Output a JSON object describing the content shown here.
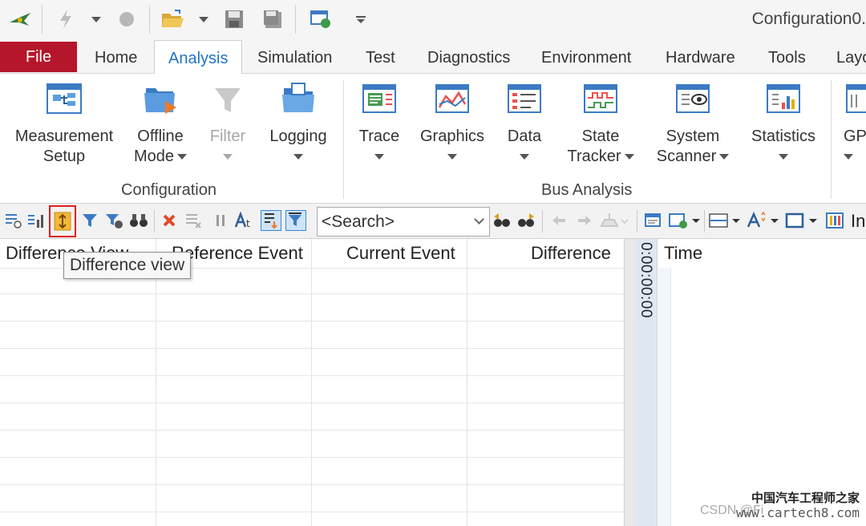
{
  "window": {
    "title": "Configuration0."
  },
  "quick_access": {
    "icons": [
      "app-logo-icon",
      "lightning-icon",
      "chevron-down-icon",
      "stop-icon",
      "open-folder-icon",
      "chevron-down-icon",
      "save-icon",
      "save-all-icon",
      "publish-icon",
      "customize-icon"
    ]
  },
  "tabs": [
    {
      "label": "File"
    },
    {
      "label": "Home"
    },
    {
      "label": "Analysis"
    },
    {
      "label": "Simulation"
    },
    {
      "label": "Test"
    },
    {
      "label": "Diagnostics"
    },
    {
      "label": "Environment"
    },
    {
      "label": "Hardware"
    },
    {
      "label": "Tools"
    },
    {
      "label": "Layo"
    }
  ],
  "ribbon": {
    "configuration": {
      "label": "Configuration",
      "buttons": [
        {
          "line1": "Measurement",
          "line2": "Setup"
        },
        {
          "line1": "Offline",
          "line2": "Mode"
        },
        {
          "line1": "Filter",
          "line2": ""
        },
        {
          "line1": "Logging",
          "line2": ""
        }
      ]
    },
    "bus_analysis": {
      "label": "Bus Analysis",
      "buttons": [
        {
          "line1": "Trace",
          "line2": ""
        },
        {
          "line1": "Graphics",
          "line2": ""
        },
        {
          "line1": "Data",
          "line2": ""
        },
        {
          "line1": "State",
          "line2": "Tracker"
        },
        {
          "line1": "System",
          "line2": "Scanner"
        },
        {
          "line1": "Statistics",
          "line2": ""
        },
        {
          "line1": "GP",
          "line2": ""
        }
      ]
    }
  },
  "toolbar": {
    "search_placeholder": "<Search>",
    "trailing_text": "In"
  },
  "grid": {
    "columns": [
      "Difference View",
      "Reference Event",
      "Current Event",
      "Difference"
    ],
    "tooltip": "Difference view"
  },
  "right_pane": {
    "axis_label": "0:00:00:00",
    "column": "Time"
  },
  "watermark": {
    "line1": "中国汽车工程师之家",
    "line2": "www.cartech8.com",
    "line3": "CSDN @Fi"
  },
  "colors": {
    "file_tab": "#b5162b",
    "active_tab_text": "#1f73c7",
    "highlight_border": "#e0201f"
  }
}
